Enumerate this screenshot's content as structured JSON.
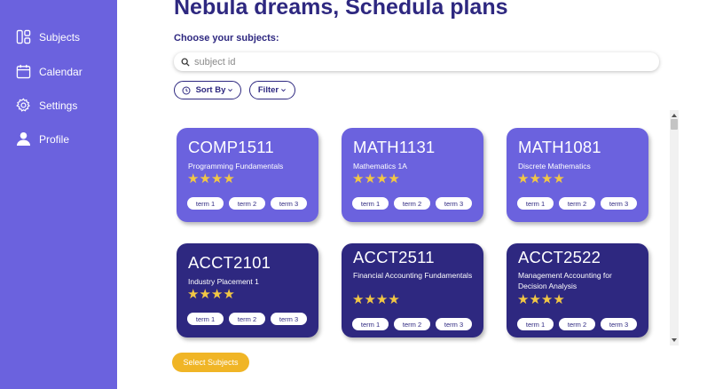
{
  "sidebar": {
    "items": [
      {
        "label": "Subjects",
        "icon": "layout-icon"
      },
      {
        "label": "Calendar",
        "icon": "calendar-icon"
      },
      {
        "label": "Settings",
        "icon": "gear-icon"
      },
      {
        "label": "Profile",
        "icon": "user-icon"
      }
    ]
  },
  "header": {
    "title": "Nebula dreams, Schedula plans",
    "subtitle": "Choose your subjects:"
  },
  "search": {
    "placeholder": "subject id",
    "value": ""
  },
  "controls": {
    "sort_label": "Sort By",
    "filter_label": "Filter"
  },
  "cards": [
    {
      "code": "COMP1511",
      "name": "Programming Fundamentals",
      "stars": "★★★★",
      "rating": 4,
      "terms": [
        "term 1",
        "term 2",
        "term 3"
      ]
    },
    {
      "code": "MATH1131",
      "name": "Mathematics 1A",
      "stars": "★★★★",
      "rating": 4,
      "terms": [
        "term 1",
        "term 2",
        "term 3"
      ]
    },
    {
      "code": "MATH1081",
      "name": "Discrete Mathematics",
      "stars": "★★★★",
      "rating": 4,
      "terms": [
        "term 1",
        "term 2",
        "term 3"
      ]
    },
    {
      "code": "ACCT2101",
      "name": "Industry Placement 1",
      "stars": "★★★★",
      "rating": 4,
      "terms": [
        "term 1",
        "term 2",
        "term 3"
      ]
    },
    {
      "code": "ACCT2511",
      "name": "Financial Accounting Fundamentals",
      "stars": "★★★★",
      "rating": 4,
      "terms": [
        "term 1",
        "term 2",
        "term 3"
      ]
    },
    {
      "code": "ACCT2522",
      "name": "Management Accounting for Decision Analysis",
      "stars": "★★★★",
      "rating": 4,
      "terms": [
        "term 1",
        "term 2",
        "term 3"
      ]
    }
  ],
  "footer": {
    "select_label": "Select Subjects"
  },
  "colors": {
    "sidebar": "#6b62de",
    "card_light": "#6b62de",
    "card_dark": "#2e2880",
    "accent": "#f0b526",
    "star": "#f2c744"
  }
}
